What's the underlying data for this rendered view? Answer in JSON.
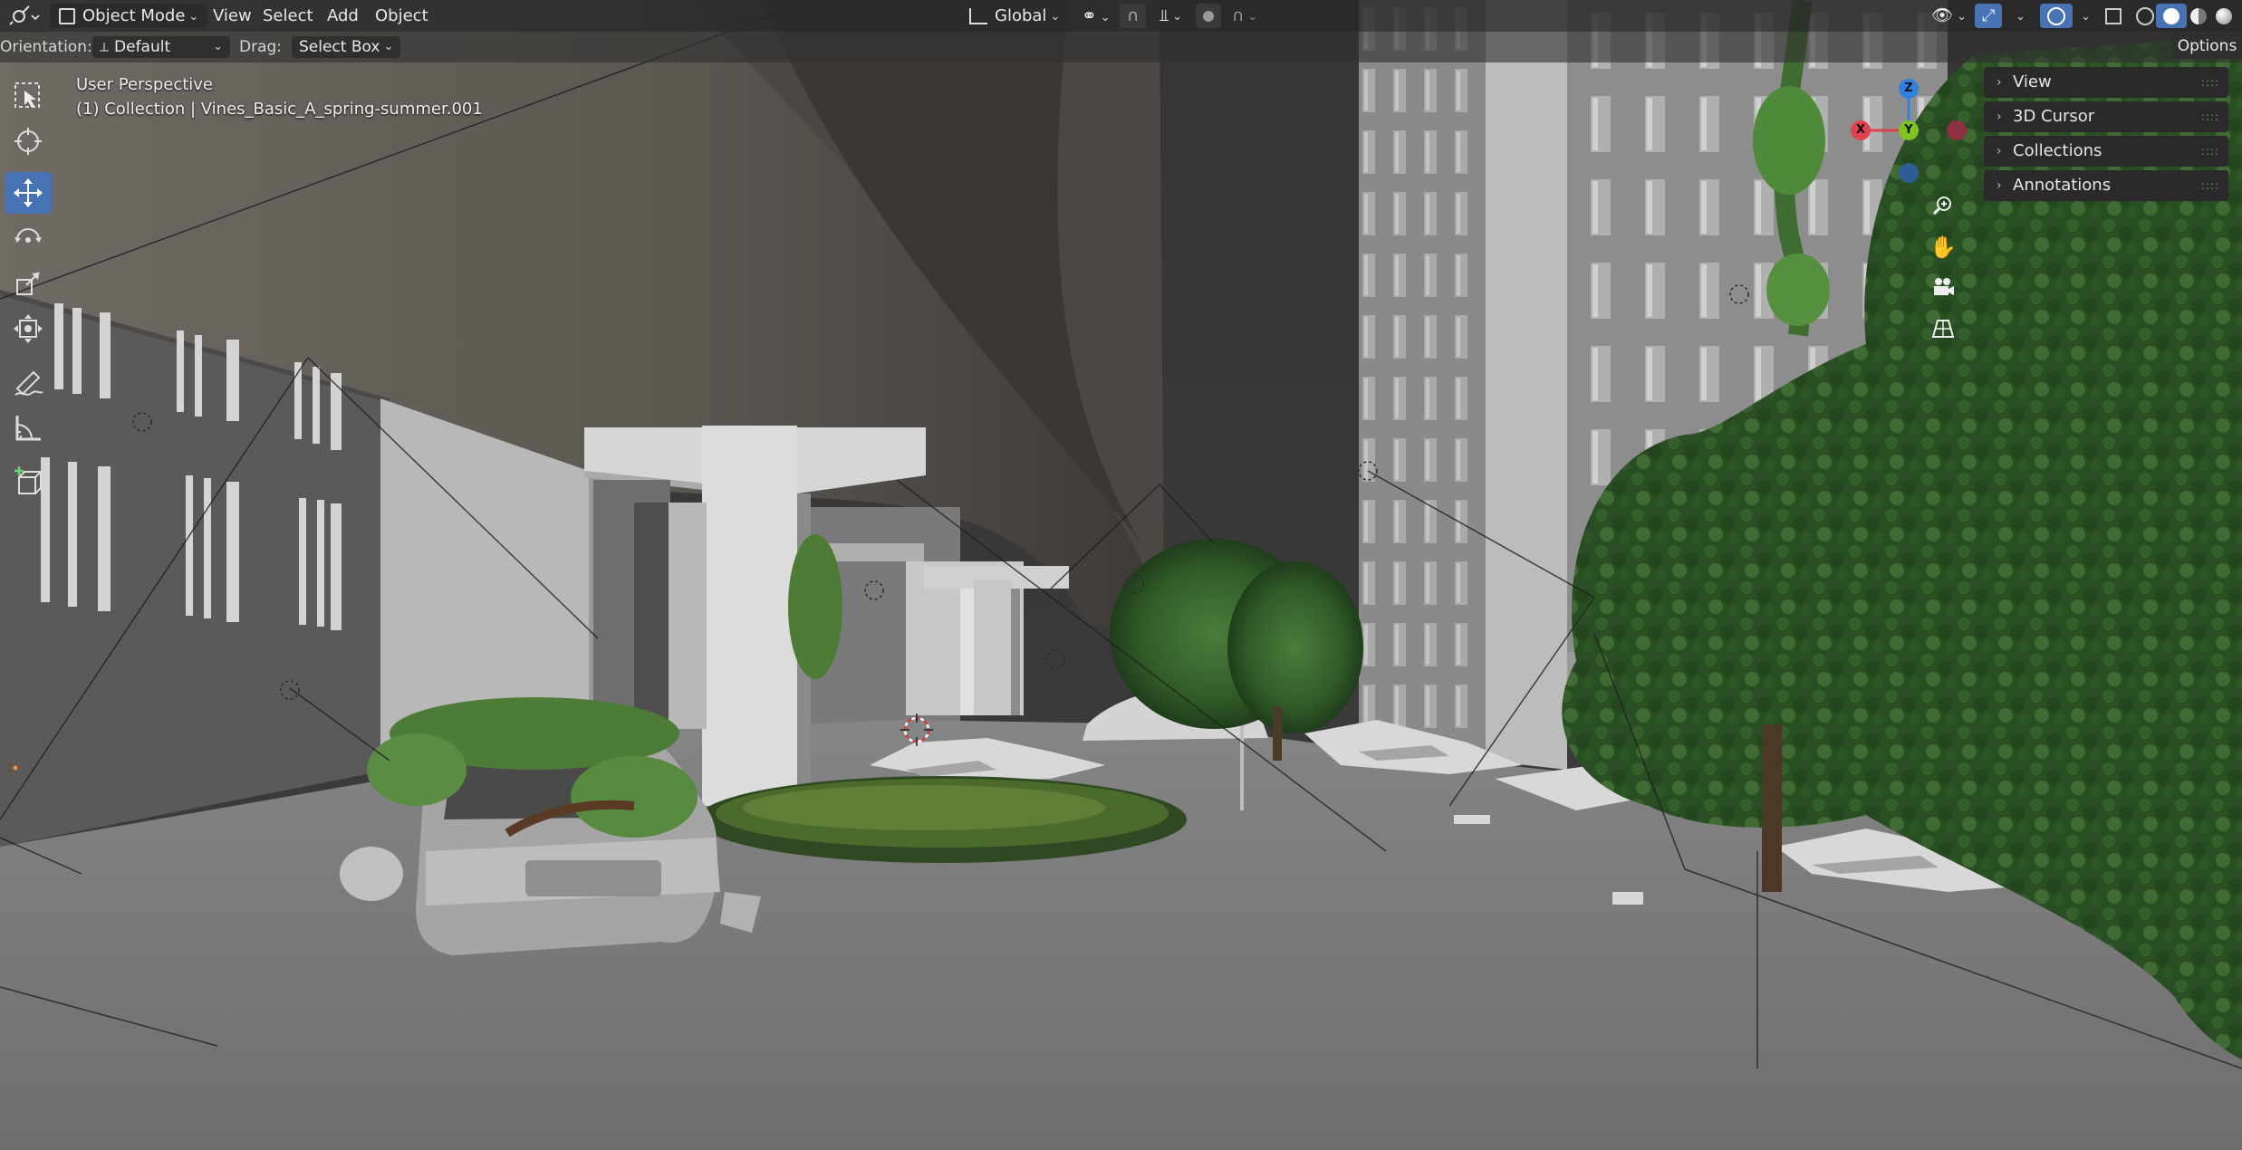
{
  "header": {
    "editor_type": "3D Viewport",
    "mode": "Object Mode",
    "menus": [
      "View",
      "Select",
      "Add",
      "Object"
    ],
    "transform_orientation": "Global",
    "snap": "off",
    "proportional_editing": "off"
  },
  "tool_settings": {
    "orientation_label": "Orientation:",
    "orientation_value": "Default",
    "drag_label": "Drag:",
    "drag_value": "Select Box",
    "options_label": "Options"
  },
  "viewport_overlay": {
    "perspective": "User Perspective",
    "active_object": "(1) Collection | Vines_Basic_A_spring-summer.001"
  },
  "toolbar": {
    "tools": [
      {
        "name": "select-box",
        "active": false
      },
      {
        "name": "cursor",
        "active": false
      },
      {
        "name": "move",
        "active": true
      },
      {
        "name": "rotate",
        "active": false
      },
      {
        "name": "scale",
        "active": false
      },
      {
        "name": "transform",
        "active": false
      },
      {
        "name": "annotate",
        "active": false
      },
      {
        "name": "measure",
        "active": false
      },
      {
        "name": "add-cube",
        "active": false
      }
    ]
  },
  "n_panel": {
    "sections": [
      "View",
      "3D Cursor",
      "Collections",
      "Annotations"
    ]
  },
  "gizmo": {
    "axes": [
      "X",
      "Y",
      "Z"
    ],
    "colors": {
      "x": "#e0424f",
      "y": "#7fc41f",
      "z": "#2f82e0"
    }
  },
  "colors": {
    "accent": "#4772b3",
    "header_bg": "#282828",
    "panel_bg": "#2a2a2a"
  }
}
